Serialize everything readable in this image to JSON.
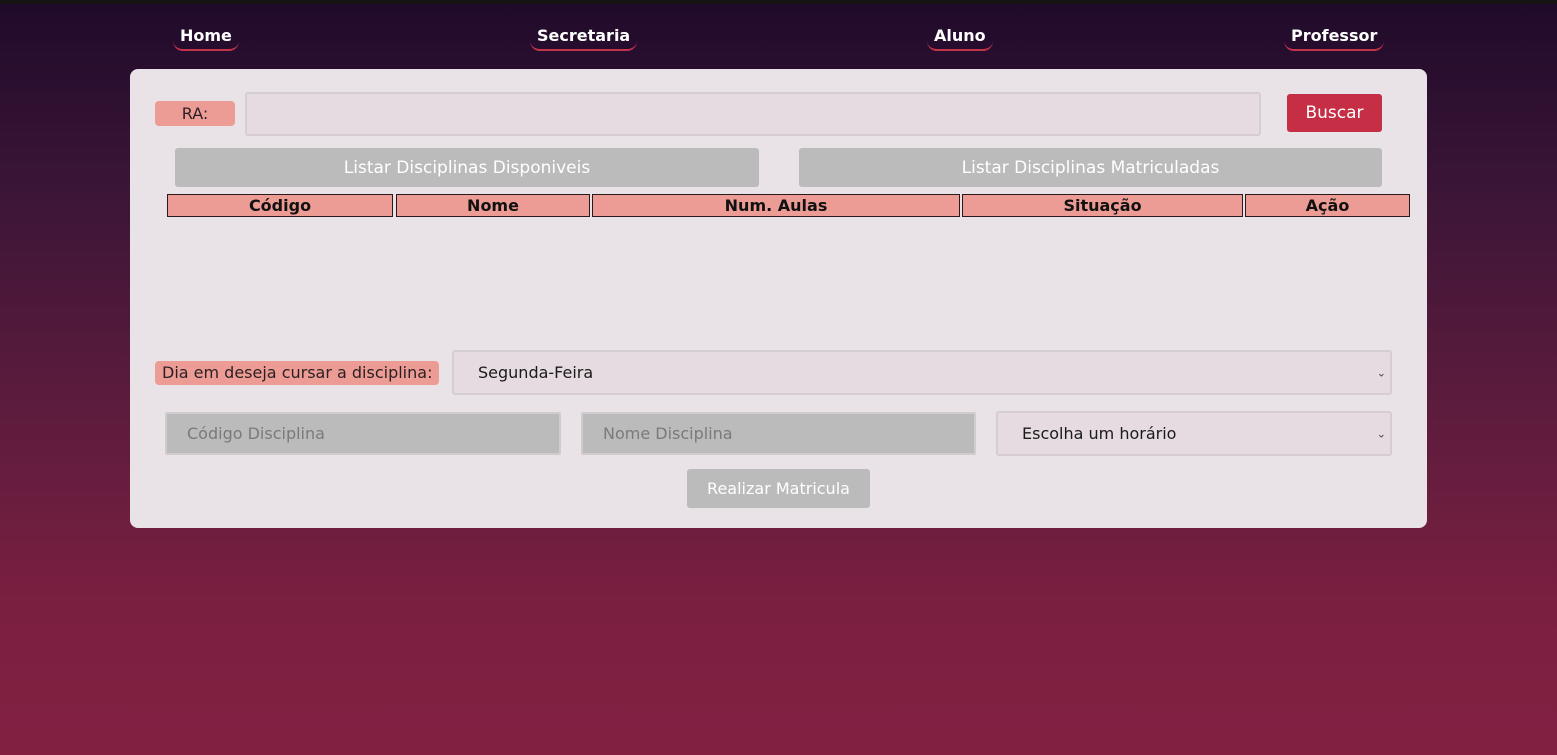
{
  "nav": {
    "home": "Home",
    "secretaria": "Secretaria",
    "aluno": "Aluno",
    "professor": "Professor"
  },
  "search": {
    "ra_label": "RA:",
    "ra_value": "",
    "buscar_label": "Buscar"
  },
  "list_buttons": {
    "disponiveis": "Listar Disciplinas Disponiveis",
    "matriculadas": "Listar Disciplinas Matriculadas"
  },
  "table": {
    "columns": [
      "Código",
      "Nome",
      "Num. Aulas",
      "Situação",
      "Ação"
    ],
    "rows": []
  },
  "dia": {
    "label": "Dia em deseja cursar a disciplina:",
    "selected": "Segunda-Feira"
  },
  "form": {
    "codigo_placeholder": "Código Disciplina",
    "nome_placeholder": "Nome Disciplina",
    "horario_selected": "Escolha um horário",
    "realizar_label": "Realizar Matricula"
  },
  "colors": {
    "accent_red": "#c62e46",
    "label_salmon": "#ec9c94",
    "button_gray": "#bbbbbb",
    "panel": "#e9e2e6"
  }
}
